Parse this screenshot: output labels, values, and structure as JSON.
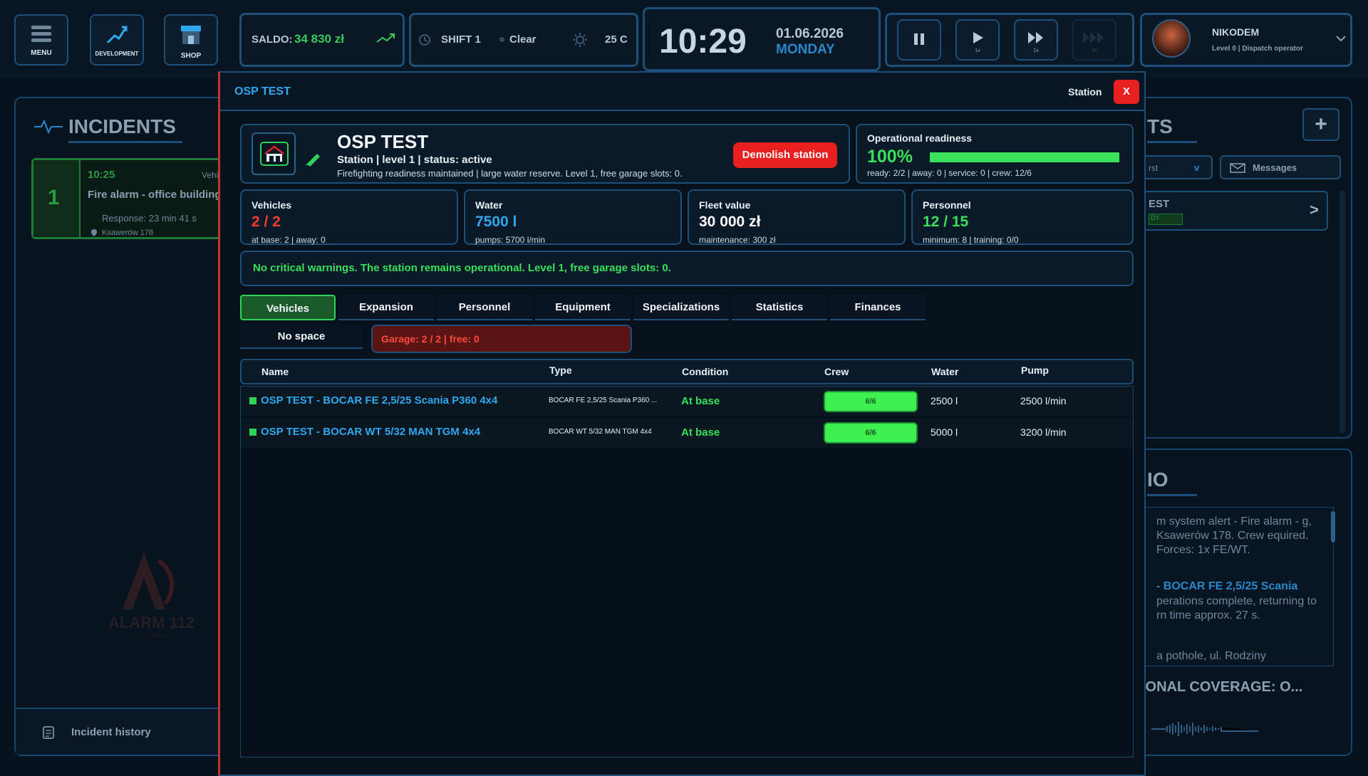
{
  "topbar": {
    "menu_label": "MENU",
    "development_label": "DEVELOPMENT",
    "shop_label": "SHOP",
    "balance_label": "SALDO:",
    "balance_value": "34 830 zł",
    "shift": "SHIFT 1",
    "weather": "Clear",
    "temperature": "25 C",
    "time": "10:29",
    "date": "01.06.2026",
    "weekday": "MONDAY",
    "speed_1": "1x",
    "speed_2": "2x",
    "speed_3": "3x",
    "user_name": "NIKODEM",
    "user_level": "Level 0 | Dispatch operator"
  },
  "incidents": {
    "title": "INCIDENTS",
    "items": [
      {
        "number": "1",
        "time": "10:25",
        "tag": "Vehicles",
        "title": "Fire alarm - office building",
        "response": "Response: 23 min 41 s",
        "address": "Ksawerów 178"
      }
    ],
    "history_label": "Incident history",
    "watermark": "ALARM 112",
    "watermark_sub": "FIRE SERVICE"
  },
  "right_panel": {
    "title_fragment": "TS",
    "filter_fragment": "rst",
    "filter_chevron": "v",
    "messages_label": "Messages",
    "station_fragment": "EST",
    "station_status": "DY",
    "radio_title_fragment": "IO",
    "radio_messages": [
      "m system alert - Fire alarm - g, Ksawerów 178. Crew equired. Forces: 1x FE/WT.",
      "- BOCAR FE 2,5/25 Scania",
      "perations complete, returning to rn time approx. 27 s.",
      "a pothole, ul. Rodziny"
    ],
    "coverage": "IONAL COVERAGE: O..."
  },
  "modal": {
    "header_title": "OSP TEST",
    "header_type": "Station",
    "close_label": "X",
    "station_name": "OSP TEST",
    "station_meta": "Station | level 1 | status: active",
    "station_desc": "Firefighting readiness maintained | large water reserve. Level 1, free garage slots: 0.",
    "demolish_label": "Demolish station",
    "readiness": {
      "label": "Operational readiness",
      "value": "100%",
      "fraction": 1.0,
      "detail": "ready: 2/2 | away: 0 | service: 0 | crew: 12/6"
    },
    "stats": [
      {
        "title": "Vehicles",
        "value": "2 / 2",
        "sub": "at base: 2 | away: 0",
        "color": "#ff3b30"
      },
      {
        "title": "Water",
        "value": "7500 l",
        "sub": "pumps: 5700 l/min",
        "color": "#2fa8f0"
      },
      {
        "title": "Fleet value",
        "value": "30 000 zł",
        "sub": "maintenance: 300 zł",
        "color": "#ffffff"
      },
      {
        "title": "Personnel",
        "value": "12 / 15",
        "sub": "minimum: 8 | training: 0/0",
        "color": "#39e05a"
      }
    ],
    "warning": "No critical warnings. The station remains operational. Level 1, free garage slots: 0.",
    "tabs": [
      "Vehicles",
      "Expansion",
      "Personnel",
      "Equipment",
      "Specializations",
      "Statistics",
      "Finances"
    ],
    "no_space_label": "No space",
    "garage_info": "Garage: 2 / 2 | free: 0",
    "table": {
      "headers": [
        "Name",
        "Type",
        "Condition",
        "Crew",
        "Water",
        "Pump"
      ],
      "rows": [
        {
          "name": "OSP TEST - BOCAR FE 2,5/25 Scania P360 4x4",
          "type": "BOCAR FE 2,5/25 Scania P360 ...",
          "condition": "At base",
          "crew": "6/6",
          "water": "2500 l",
          "pump": "2500 l/min"
        },
        {
          "name": "OSP TEST - BOCAR WT 5/32 MAN TGM 4x4",
          "type": "BOCAR WT 5/32 MAN TGM 4x4",
          "condition": "At base",
          "crew": "6/6",
          "water": "5000 l",
          "pump": "3200 l/min"
        }
      ]
    }
  },
  "colors": {
    "accent_green": "#39e05a",
    "accent_blue": "#2fa8f0",
    "danger_red": "#e8201f",
    "border_blue": "#1d4f78"
  }
}
